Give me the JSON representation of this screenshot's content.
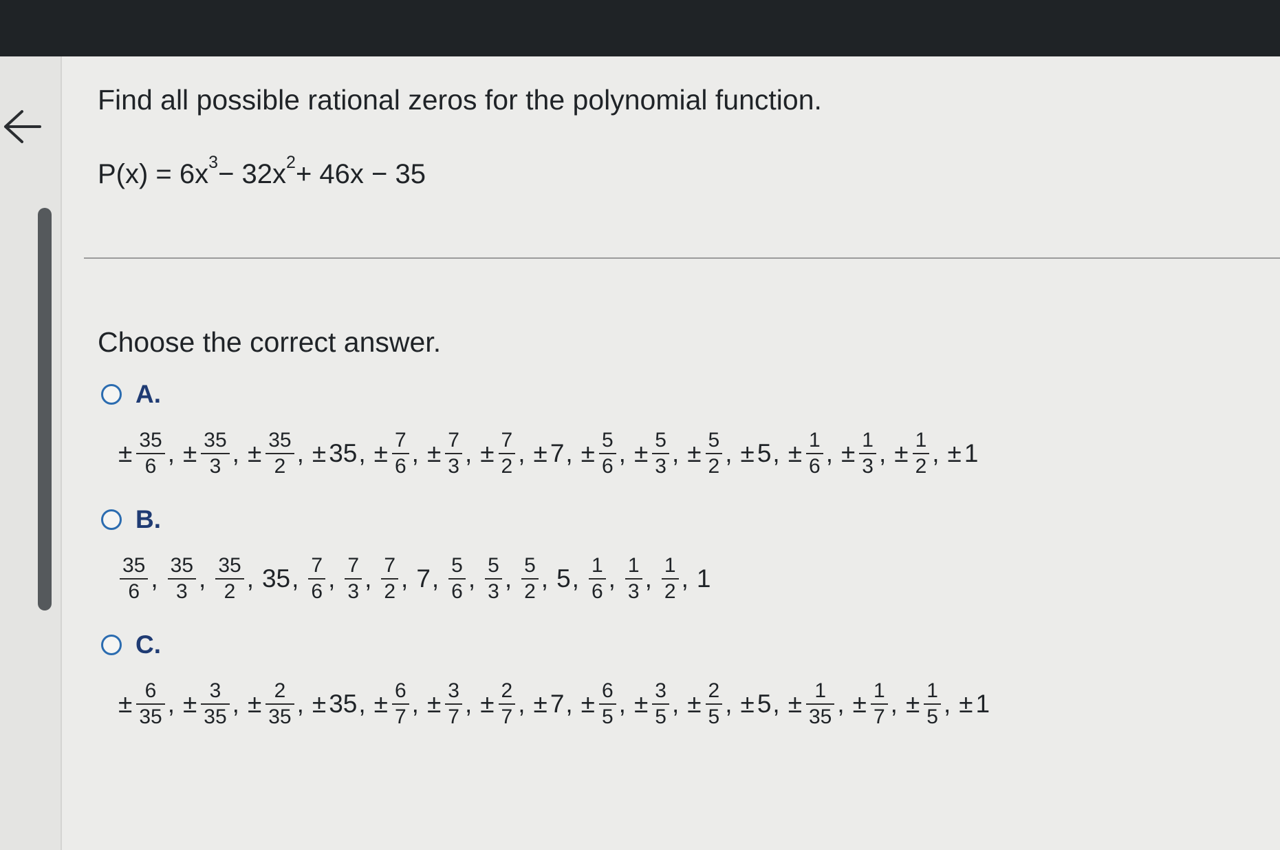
{
  "question": {
    "text": "Find all possible rational zeros for the polynomial function.",
    "function_name": "P(x) = 6x",
    "exp1": "3",
    "term2": " − 32x",
    "exp2": "2",
    "term3": " + 46x − 35"
  },
  "prompt": "Choose the correct answer.",
  "options": [
    {
      "letter": "A.",
      "terms": [
        {
          "sign": "±",
          "num": "35",
          "den": "6"
        },
        {
          "sign": "±",
          "num": "35",
          "den": "3"
        },
        {
          "sign": "±",
          "num": "35",
          "den": "2"
        },
        {
          "sign": "±",
          "val": "35"
        },
        {
          "sign": "±",
          "num": "7",
          "den": "6"
        },
        {
          "sign": "±",
          "num": "7",
          "den": "3"
        },
        {
          "sign": "±",
          "num": "7",
          "den": "2"
        },
        {
          "sign": "±",
          "val": "7"
        },
        {
          "sign": "±",
          "num": "5",
          "den": "6"
        },
        {
          "sign": "±",
          "num": "5",
          "den": "3"
        },
        {
          "sign": "±",
          "num": "5",
          "den": "2"
        },
        {
          "sign": "±",
          "val": "5"
        },
        {
          "sign": "±",
          "num": "1",
          "den": "6"
        },
        {
          "sign": "±",
          "num": "1",
          "den": "3"
        },
        {
          "sign": "±",
          "num": "1",
          "den": "2"
        },
        {
          "sign": "±",
          "val": "1"
        }
      ]
    },
    {
      "letter": "B.",
      "terms": [
        {
          "sign": "",
          "num": "35",
          "den": "6"
        },
        {
          "sign": "",
          "num": "35",
          "den": "3"
        },
        {
          "sign": "",
          "num": "35",
          "den": "2"
        },
        {
          "sign": "",
          "val": "35"
        },
        {
          "sign": "",
          "num": "7",
          "den": "6"
        },
        {
          "sign": "",
          "num": "7",
          "den": "3"
        },
        {
          "sign": "",
          "num": "7",
          "den": "2"
        },
        {
          "sign": "",
          "val": "7"
        },
        {
          "sign": "",
          "num": "5",
          "den": "6"
        },
        {
          "sign": "",
          "num": "5",
          "den": "3"
        },
        {
          "sign": "",
          "num": "5",
          "den": "2"
        },
        {
          "sign": "",
          "val": "5"
        },
        {
          "sign": "",
          "num": "1",
          "den": "6"
        },
        {
          "sign": "",
          "num": "1",
          "den": "3"
        },
        {
          "sign": "",
          "num": "1",
          "den": "2"
        },
        {
          "sign": "",
          "val": "1"
        }
      ]
    },
    {
      "letter": "C.",
      "terms": [
        {
          "sign": "±",
          "num": "6",
          "den": "35"
        },
        {
          "sign": "±",
          "num": "3",
          "den": "35"
        },
        {
          "sign": "±",
          "num": "2",
          "den": "35"
        },
        {
          "sign": "±",
          "val": "35"
        },
        {
          "sign": "±",
          "num": "6",
          "den": "7"
        },
        {
          "sign": "±",
          "num": "3",
          "den": "7"
        },
        {
          "sign": "±",
          "num": "2",
          "den": "7"
        },
        {
          "sign": "±",
          "val": "7"
        },
        {
          "sign": "±",
          "num": "6",
          "den": "5"
        },
        {
          "sign": "±",
          "num": "3",
          "den": "5"
        },
        {
          "sign": "±",
          "num": "2",
          "den": "5"
        },
        {
          "sign": "±",
          "val": "5"
        },
        {
          "sign": "±",
          "num": "1",
          "den": "35"
        },
        {
          "sign": "±",
          "num": "1",
          "den": "7"
        },
        {
          "sign": "±",
          "num": "1",
          "den": "5"
        },
        {
          "sign": "±",
          "val": "1"
        }
      ]
    }
  ],
  "icons": {
    "back": "back-arrow-icon",
    "radio": "radio-button-icon"
  },
  "colors": {
    "accent": "#2b6cb0",
    "letter": "#1f3b73",
    "topbar": "#1f2326"
  }
}
